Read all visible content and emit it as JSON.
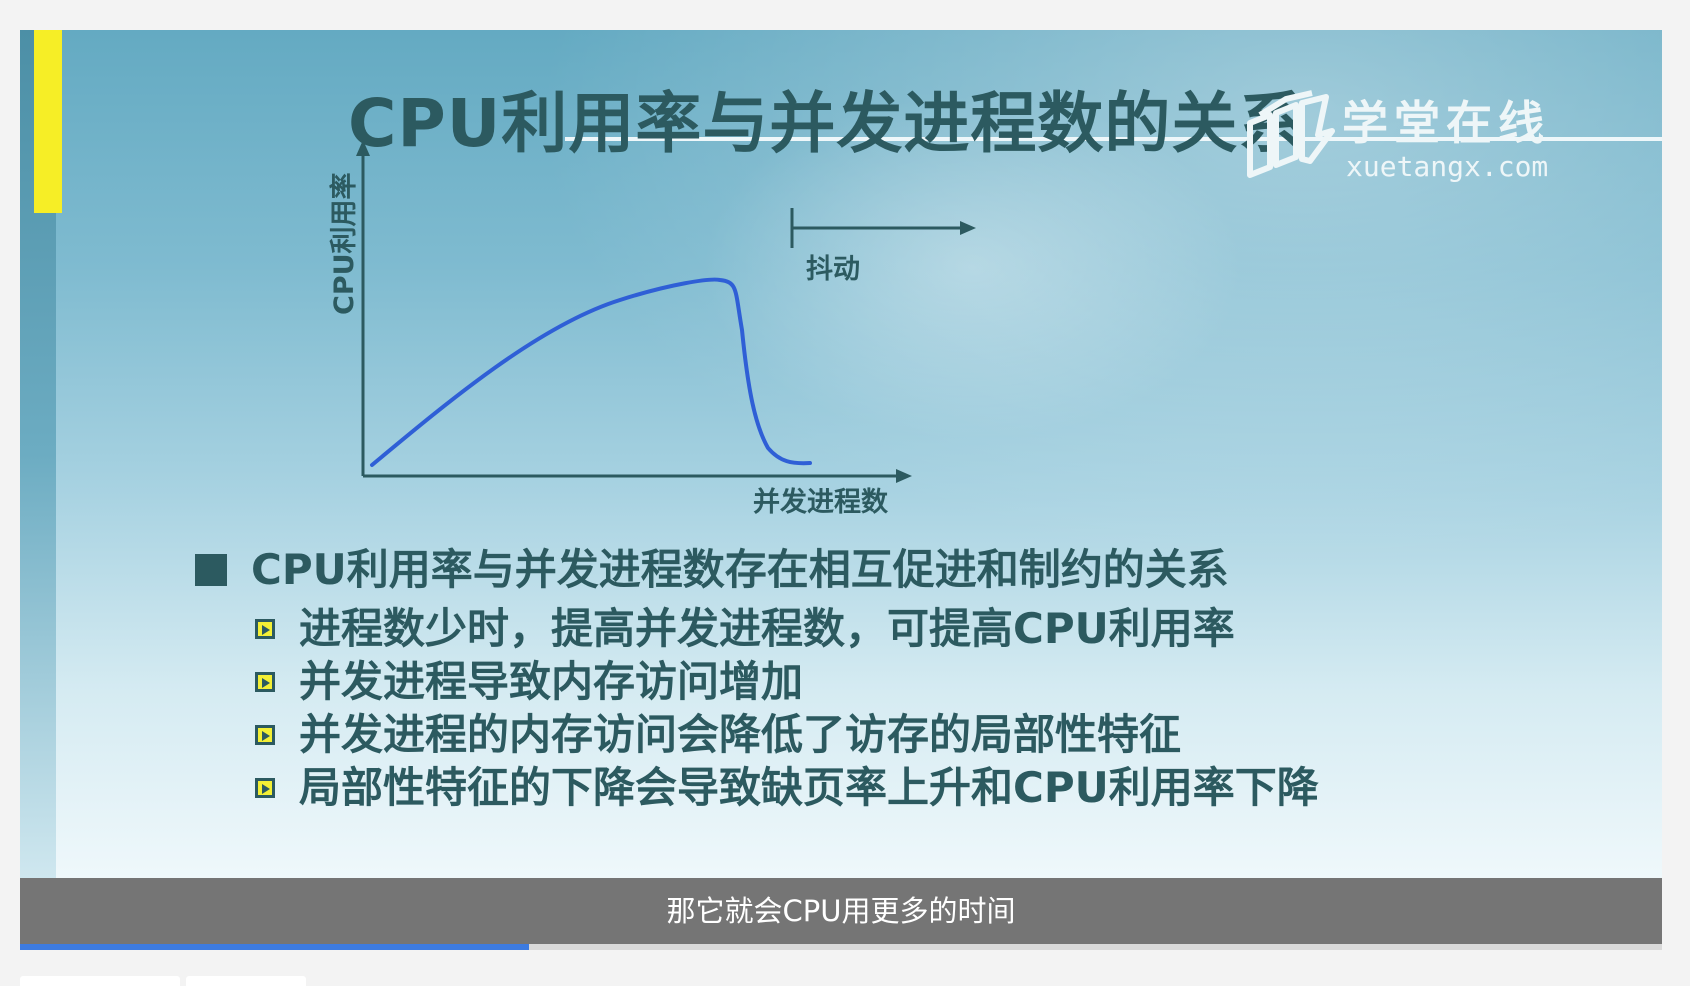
{
  "slide": {
    "title": "CPU利用率与并发进程数的关系",
    "watermark": {
      "name_cn": "学堂在线",
      "site": "xuetangx.com"
    },
    "chart": {
      "y_axis_label": "CPU利用率",
      "x_axis_label": "并发进程数",
      "annotation": "抖动",
      "curve_color": "#2f5fd6"
    },
    "main_bullet": "CPU利用率与并发进程数存在相互促进和制约的关系",
    "sub_bullets": [
      "进程数少时，提高并发进程数，可提高CPU利用率",
      "并发进程导致内存访问增加",
      "并发进程的内存访问会降低了访存的局部性特征",
      "局部性特征的下降会导致缺页率上升和CPU利用率下降"
    ]
  },
  "player": {
    "caption": "那它就会CPU用更多的时间",
    "progress": 0.31
  },
  "colors": {
    "slide_text": "#2c5a60",
    "accent_yellow": "#f6ee26",
    "progress": "#3d7be0"
  }
}
